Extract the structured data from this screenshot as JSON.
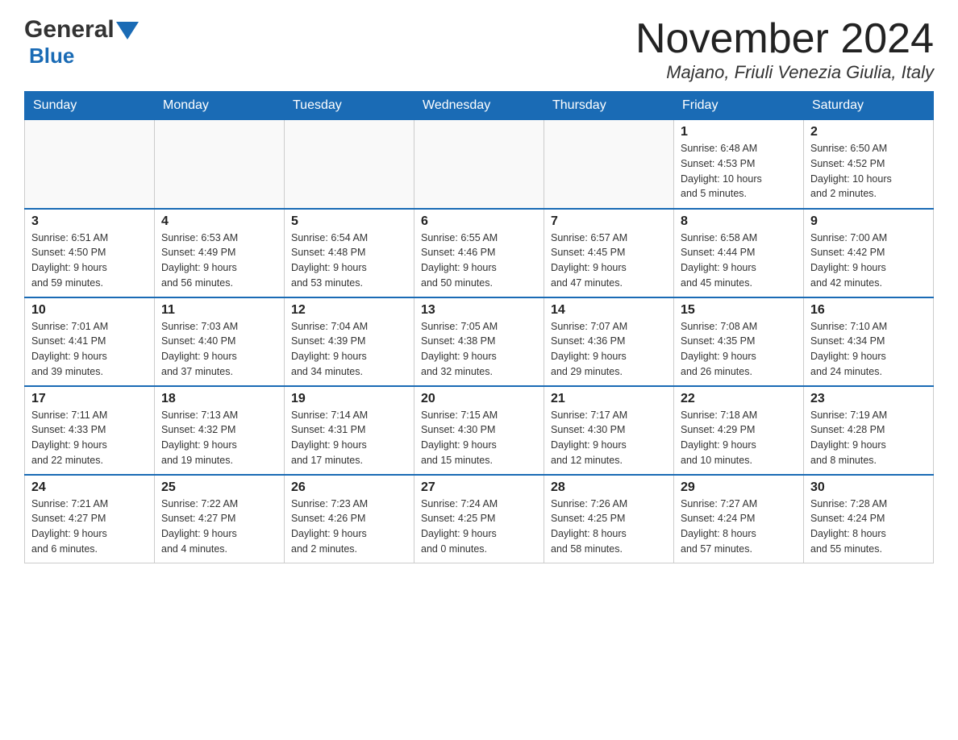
{
  "header": {
    "title": "November 2024",
    "location": "Majano, Friuli Venezia Giulia, Italy",
    "logo_general": "General",
    "logo_blue": "Blue"
  },
  "weekdays": [
    "Sunday",
    "Monday",
    "Tuesday",
    "Wednesday",
    "Thursday",
    "Friday",
    "Saturday"
  ],
  "weeks": [
    [
      {
        "day": "",
        "info": ""
      },
      {
        "day": "",
        "info": ""
      },
      {
        "day": "",
        "info": ""
      },
      {
        "day": "",
        "info": ""
      },
      {
        "day": "",
        "info": ""
      },
      {
        "day": "1",
        "info": "Sunrise: 6:48 AM\nSunset: 4:53 PM\nDaylight: 10 hours\nand 5 minutes."
      },
      {
        "day": "2",
        "info": "Sunrise: 6:50 AM\nSunset: 4:52 PM\nDaylight: 10 hours\nand 2 minutes."
      }
    ],
    [
      {
        "day": "3",
        "info": "Sunrise: 6:51 AM\nSunset: 4:50 PM\nDaylight: 9 hours\nand 59 minutes."
      },
      {
        "day": "4",
        "info": "Sunrise: 6:53 AM\nSunset: 4:49 PM\nDaylight: 9 hours\nand 56 minutes."
      },
      {
        "day": "5",
        "info": "Sunrise: 6:54 AM\nSunset: 4:48 PM\nDaylight: 9 hours\nand 53 minutes."
      },
      {
        "day": "6",
        "info": "Sunrise: 6:55 AM\nSunset: 4:46 PM\nDaylight: 9 hours\nand 50 minutes."
      },
      {
        "day": "7",
        "info": "Sunrise: 6:57 AM\nSunset: 4:45 PM\nDaylight: 9 hours\nand 47 minutes."
      },
      {
        "day": "8",
        "info": "Sunrise: 6:58 AM\nSunset: 4:44 PM\nDaylight: 9 hours\nand 45 minutes."
      },
      {
        "day": "9",
        "info": "Sunrise: 7:00 AM\nSunset: 4:42 PM\nDaylight: 9 hours\nand 42 minutes."
      }
    ],
    [
      {
        "day": "10",
        "info": "Sunrise: 7:01 AM\nSunset: 4:41 PM\nDaylight: 9 hours\nand 39 minutes."
      },
      {
        "day": "11",
        "info": "Sunrise: 7:03 AM\nSunset: 4:40 PM\nDaylight: 9 hours\nand 37 minutes."
      },
      {
        "day": "12",
        "info": "Sunrise: 7:04 AM\nSunset: 4:39 PM\nDaylight: 9 hours\nand 34 minutes."
      },
      {
        "day": "13",
        "info": "Sunrise: 7:05 AM\nSunset: 4:38 PM\nDaylight: 9 hours\nand 32 minutes."
      },
      {
        "day": "14",
        "info": "Sunrise: 7:07 AM\nSunset: 4:36 PM\nDaylight: 9 hours\nand 29 minutes."
      },
      {
        "day": "15",
        "info": "Sunrise: 7:08 AM\nSunset: 4:35 PM\nDaylight: 9 hours\nand 26 minutes."
      },
      {
        "day": "16",
        "info": "Sunrise: 7:10 AM\nSunset: 4:34 PM\nDaylight: 9 hours\nand 24 minutes."
      }
    ],
    [
      {
        "day": "17",
        "info": "Sunrise: 7:11 AM\nSunset: 4:33 PM\nDaylight: 9 hours\nand 22 minutes."
      },
      {
        "day": "18",
        "info": "Sunrise: 7:13 AM\nSunset: 4:32 PM\nDaylight: 9 hours\nand 19 minutes."
      },
      {
        "day": "19",
        "info": "Sunrise: 7:14 AM\nSunset: 4:31 PM\nDaylight: 9 hours\nand 17 minutes."
      },
      {
        "day": "20",
        "info": "Sunrise: 7:15 AM\nSunset: 4:30 PM\nDaylight: 9 hours\nand 15 minutes."
      },
      {
        "day": "21",
        "info": "Sunrise: 7:17 AM\nSunset: 4:30 PM\nDaylight: 9 hours\nand 12 minutes."
      },
      {
        "day": "22",
        "info": "Sunrise: 7:18 AM\nSunset: 4:29 PM\nDaylight: 9 hours\nand 10 minutes."
      },
      {
        "day": "23",
        "info": "Sunrise: 7:19 AM\nSunset: 4:28 PM\nDaylight: 9 hours\nand 8 minutes."
      }
    ],
    [
      {
        "day": "24",
        "info": "Sunrise: 7:21 AM\nSunset: 4:27 PM\nDaylight: 9 hours\nand 6 minutes."
      },
      {
        "day": "25",
        "info": "Sunrise: 7:22 AM\nSunset: 4:27 PM\nDaylight: 9 hours\nand 4 minutes."
      },
      {
        "day": "26",
        "info": "Sunrise: 7:23 AM\nSunset: 4:26 PM\nDaylight: 9 hours\nand 2 minutes."
      },
      {
        "day": "27",
        "info": "Sunrise: 7:24 AM\nSunset: 4:25 PM\nDaylight: 9 hours\nand 0 minutes."
      },
      {
        "day": "28",
        "info": "Sunrise: 7:26 AM\nSunset: 4:25 PM\nDaylight: 8 hours\nand 58 minutes."
      },
      {
        "day": "29",
        "info": "Sunrise: 7:27 AM\nSunset: 4:24 PM\nDaylight: 8 hours\nand 57 minutes."
      },
      {
        "day": "30",
        "info": "Sunrise: 7:28 AM\nSunset: 4:24 PM\nDaylight: 8 hours\nand 55 minutes."
      }
    ]
  ]
}
